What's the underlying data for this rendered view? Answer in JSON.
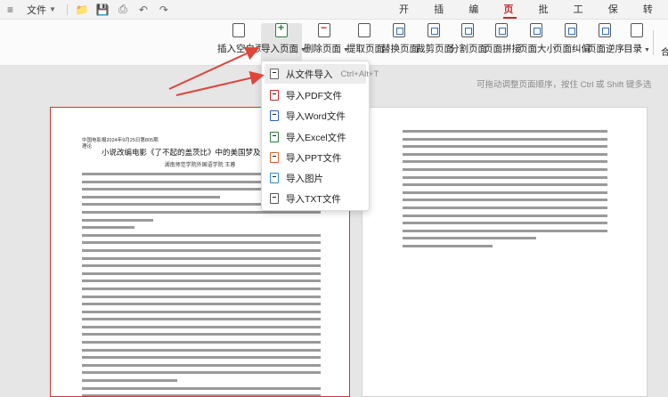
{
  "menubar": {
    "file_label": "文件",
    "quick_access": [
      "folder-icon",
      "save-icon",
      "print-icon",
      "undo-icon",
      "redo-icon"
    ]
  },
  "tabs": [
    "开始",
    "插入",
    "编辑",
    "页面",
    "批注",
    "工具",
    "保护",
    "转换"
  ],
  "active_tab": "页面",
  "ribbon": {
    "buttons": [
      {
        "label": "插入空白页",
        "icon": "blank-page-icon"
      },
      {
        "label": "导入页面",
        "icon": "import-page-icon"
      },
      {
        "label": "删除页面",
        "icon": "delete-page-icon"
      },
      {
        "label": "提取页面",
        "icon": "extract-page-icon"
      },
      {
        "label": "替换页面",
        "icon": "replace-page-icon"
      },
      {
        "label": "裁剪页面",
        "icon": "crop-page-icon"
      },
      {
        "label": "分割页面",
        "icon": "split-page-icon"
      },
      {
        "label": "页面拼接",
        "icon": "merge-page-icon"
      },
      {
        "label": "页面大小",
        "icon": "page-size-icon"
      },
      {
        "label": "页面纠偏",
        "icon": "deskew-page-icon"
      },
      {
        "label": "页面逆序",
        "icon": "reverse-page-icon"
      },
      {
        "label": "目录",
        "icon": "toc-icon"
      }
    ],
    "more_label": "合"
  },
  "hint": "可拖动调整页面顺序，按住 Ctrl 或 Shift 键多选",
  "dropdown": {
    "items": [
      {
        "label": "从文件导入",
        "shortcut": "Ctrl+Alt+T",
        "icon": "file-import-icon"
      },
      {
        "label": "导入PDF文件",
        "icon": "pdf-file-icon"
      },
      {
        "label": "导入Word文件",
        "icon": "word-file-icon"
      },
      {
        "label": "导入Excel文件",
        "icon": "excel-file-icon"
      },
      {
        "label": "导入PPT文件",
        "icon": "ppt-file-icon"
      },
      {
        "label": "导入图片",
        "icon": "image-file-icon"
      },
      {
        "label": "导入TXT文件",
        "icon": "txt-file-icon"
      }
    ]
  },
  "document": {
    "header_line1": "中国电影报2024年9月25日第805期",
    "header_line2": "理论",
    "title": "小说改编电影《了不起的盖茨比》中的美国梦及其叙事艺术",
    "author": "湖南师范学院外国语学院 王蓉"
  },
  "colors": {
    "accent": "#c22a2a",
    "arrow": "#e0453a"
  }
}
